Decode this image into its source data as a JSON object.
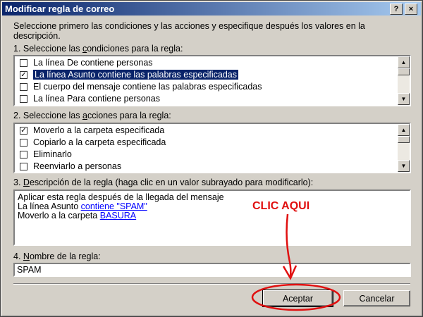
{
  "window": {
    "title": "Modificar regla de correo"
  },
  "titlebar": {
    "help_label": "?",
    "close_label": "×"
  },
  "intro": "Seleccione primero las condiciones y las acciones y especifique después los valores en la descripción.",
  "conditions": {
    "heading": {
      "before": "1. Seleccione las ",
      "accel": "c",
      "after": "ondiciones para la regla:"
    },
    "items": [
      {
        "label": "La línea De contiene personas",
        "checked": false,
        "selected": false
      },
      {
        "label": "La línea Asunto contiene las palabras especificadas",
        "checked": true,
        "selected": true
      },
      {
        "label": "El cuerpo del mensaje contiene las palabras especificadas",
        "checked": false,
        "selected": false
      },
      {
        "label": "La línea Para contiene personas",
        "checked": false,
        "selected": false
      }
    ]
  },
  "actions": {
    "heading": {
      "before": "2. Seleccione las ",
      "accel": "a",
      "after": "cciones para la regla:"
    },
    "items": [
      {
        "label": "Moverlo a la carpeta especificada",
        "checked": true,
        "selected": false
      },
      {
        "label": "Copiarlo a la carpeta especificada",
        "checked": false,
        "selected": false
      },
      {
        "label": "Eliminarlo",
        "checked": false,
        "selected": false
      },
      {
        "label": "Reenviarlo a personas",
        "checked": false,
        "selected": false
      }
    ]
  },
  "description": {
    "heading": {
      "before": "3. ",
      "accel": "D",
      "after": "escripción de la regla (haga clic en un valor subrayado para modificarlo):"
    },
    "line1": "Aplicar esta regla después de la llegada del mensaje",
    "line2_prefix": "La línea Asunto ",
    "line2_link": "contiene \"SPAM\"",
    "line3_prefix": "Moverlo a la carpeta ",
    "line3_link": "BASURA"
  },
  "rule_name": {
    "heading": {
      "before": "4. ",
      "accel": "N",
      "after": "ombre de la regla:"
    },
    "value": "SPAM"
  },
  "buttons": {
    "ok_label": "Aceptar",
    "cancel_label": "Cancelar"
  },
  "annotation": {
    "label": "CLIC AQUI",
    "color": "#e01010"
  },
  "icons": {
    "checkbox": "checkbox-icon",
    "scroll_up": "scroll-up-arrow-icon",
    "scroll_down": "scroll-down-arrow-icon"
  },
  "colors": {
    "titlebar": "#0a246a",
    "selection": "#0a246a",
    "link": "#0000ff",
    "dialog": "#d4d0c8"
  }
}
